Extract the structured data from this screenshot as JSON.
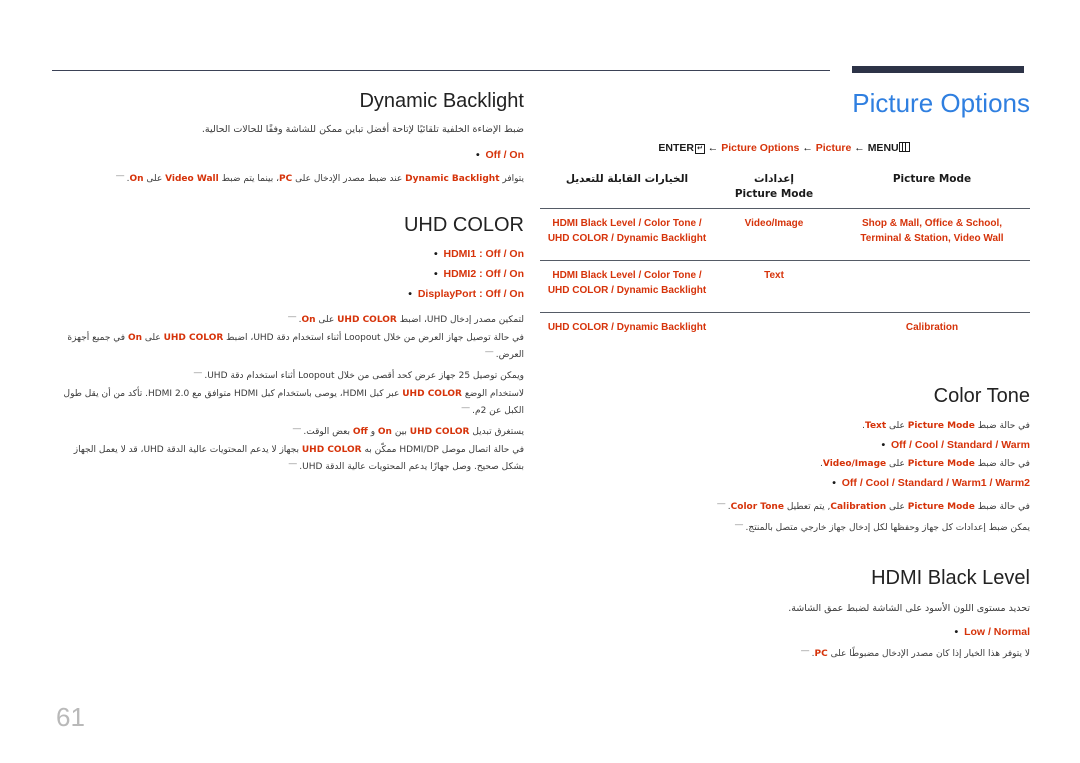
{
  "page": {
    "number": "61",
    "accent_blue": "#2f7fe0",
    "accent_red": "#d6330a",
    "rule_color": "#3b4256"
  },
  "right_column": {
    "title": "Picture Options",
    "menu_path": {
      "enter": "ENTER",
      "seg_options": "Picture Options",
      "seg_picture": "Picture",
      "menu": "MENU"
    },
    "table": {
      "headers": {
        "col_adjustable": "الخيارات القابلة للتعديل",
        "col_settings_line1": "إعدادات",
        "col_settings_line2": "Picture Mode",
        "col_mode": "Picture Mode"
      },
      "rows": [
        {
          "adjustable_line1": "HDMI Black Level / Color Tone /",
          "adjustable_line2": "UHD COLOR / Dynamic Backlight",
          "settings": "Video/Image",
          "mode_line1": "Shop & Mall, Office & School,",
          "mode_line2": "Terminal & Station, Video Wall"
        },
        {
          "adjustable_line1": "HDMI Black Level / Color Tone /",
          "adjustable_line2": "UHD COLOR / Dynamic Backlight",
          "settings": "Text",
          "mode_line1": "",
          "mode_line2": ""
        },
        {
          "adjustable_line1": "UHD COLOR / Dynamic Backlight",
          "adjustable_line2": "",
          "settings": "",
          "mode_line1": "Calibration",
          "mode_line2": ""
        }
      ]
    },
    "color_tone": {
      "heading": "Color Tone",
      "line1_pre": "في حالة ضبط ",
      "line1_bold1": "Picture Mode",
      "line1_mid": " على ",
      "line1_bold2": "Text",
      "line1_post": ".",
      "options1": "Off / Cool / Standard / Warm",
      "line2_pre": "في حالة ضبط ",
      "line2_bold1": "Picture Mode",
      "line2_mid": " على ",
      "line2_bold2": "Video/Image",
      "line2_post": ".",
      "options2": "Off / Cool / Standard / Warm1 / Warm2",
      "note1_pre": "في حالة ضبط ",
      "note1_b1": "Picture Mode",
      "note1_mid": " على ",
      "note1_b2": "Calibration",
      "note1_mid2": ", يتم تعطيل ",
      "note1_b3": "Color Tone",
      "note1_post": ".",
      "note2": "يمكن ضبط إعدادات كل جهاز وحفظها لكل إدخال جهاز خارجي متصل بالمنتج."
    },
    "hdmi_black_level": {
      "heading": "HDMI Black Level",
      "description": "تحديد مستوى اللون الأسود على الشاشة لضبط عمق الشاشة.",
      "options": "Low / Normal",
      "note_pre": "لا يتوفر هذا الخيار إذا كان مصدر الإدخال مضبوطًا على ",
      "note_bold": "PC",
      "note_post": "."
    }
  },
  "left_column": {
    "dynamic_backlight": {
      "heading": "Dynamic Backlight",
      "description": "ضبط الإضاءة الخلفية تلقائيًا لإتاحة أفضل تباين ممكن للشاشة وفقًا للحالات الحالية.",
      "options": "Off / On",
      "note_pre": "يتوافر ",
      "note_b1": "Dynamic Backlight",
      "note_mid1": " عند ضبط مصدر الإدخال على ",
      "note_b2": "PC",
      "note_mid2": "، بينما يتم ضبط ",
      "note_b3": "Video Wall",
      "note_mid3": " على ",
      "note_b4": "On",
      "note_post": "."
    },
    "uhd_color": {
      "heading": "UHD COLOR",
      "options": [
        "HDMI1 : Off / On",
        "HDMI2 : Off / On",
        "DisplayPort : Off / On"
      ],
      "notes": [
        {
          "parts": [
            {
              "t": "لتمكين مصدر إدخال UHD، اضبط ",
              "b": false
            },
            {
              "t": "UHD COLOR",
              "b": true
            },
            {
              "t": " على ",
              "b": false
            },
            {
              "t": "On",
              "b": true
            },
            {
              "t": ".",
              "b": false
            }
          ]
        },
        {
          "parts": [
            {
              "t": "في حالة توصيل جهاز العرض من خلال Loopout أثناء استخدام دقة UHD، اضبط ",
              "b": false
            },
            {
              "t": "UHD COLOR",
              "b": true
            },
            {
              "t": " على ",
              "b": false
            },
            {
              "t": "On",
              "b": true
            },
            {
              "t": " في جميع أجهزة العرض.",
              "b": false
            }
          ]
        },
        {
          "parts": [
            {
              "t": "ويمكن توصيل 25 جهاز عرض كحد أقصى من خلال Loopout أثناء استخدام دقة UHD.",
              "b": false
            }
          ]
        },
        {
          "parts": [
            {
              "t": "لاستخدام الوضع ",
              "b": false
            },
            {
              "t": "UHD COLOR",
              "b": true
            },
            {
              "t": " عبر كبل HDMI، يوصى باستخدام كبل HDMI متوافق مع HDMI 2.0. تأكد من أن يقل طول الكبل عن 2م.",
              "b": false
            }
          ]
        },
        {
          "parts": [
            {
              "t": "يستغرق تبديل ",
              "b": false
            },
            {
              "t": "UHD COLOR",
              "b": true
            },
            {
              "t": " بين ",
              "b": false
            },
            {
              "t": "On",
              "b": true
            },
            {
              "t": " و ",
              "b": false
            },
            {
              "t": "Off",
              "b": true
            },
            {
              "t": " بعض الوقت.",
              "b": false
            }
          ]
        },
        {
          "parts": [
            {
              "t": "في حالة اتصال موصل HDMI/DP ممكّن به ",
              "b": false
            },
            {
              "t": "UHD COLOR",
              "b": true
            },
            {
              "t": " بجهاز لا يدعم المحتويات عالية الدقة UHD، قد لا يعمل الجهاز بشكل صحيح. وصل جهازًا يدعم المحتويات عالية الدقة UHD.",
              "b": false
            }
          ]
        }
      ]
    }
  }
}
